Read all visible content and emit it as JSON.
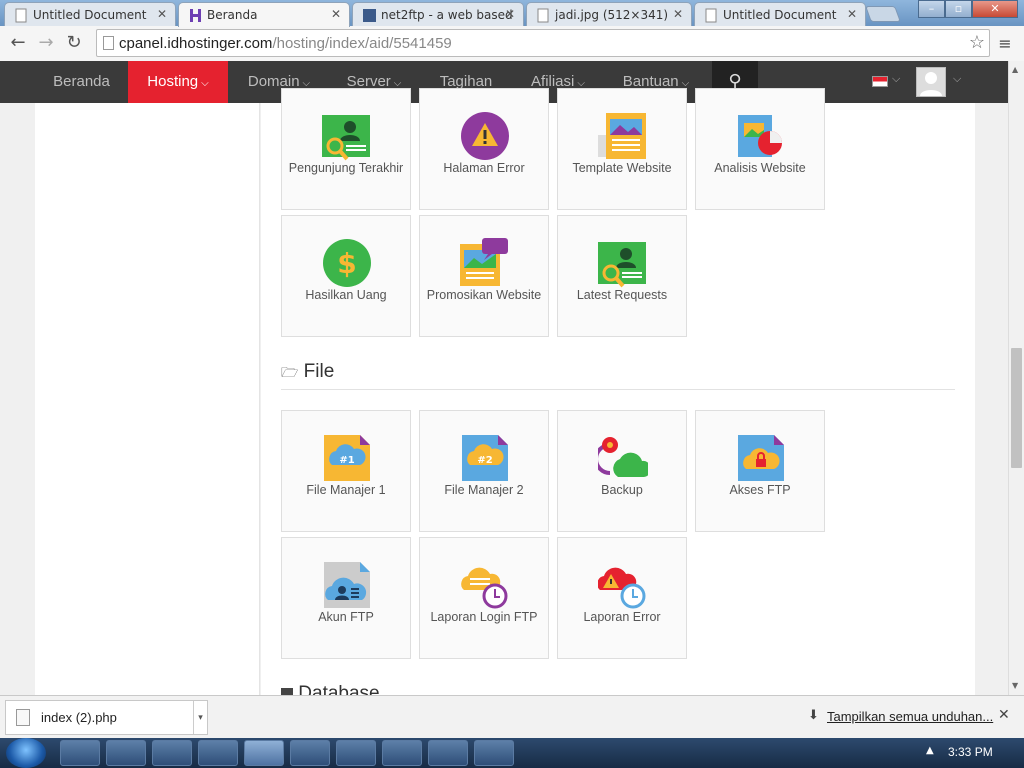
{
  "browser": {
    "tabs": [
      {
        "title": "Untitled Document",
        "active": false
      },
      {
        "title": "Beranda",
        "active": true
      },
      {
        "title": "net2ftp - a web based",
        "active": false
      },
      {
        "title": "jadi.jpg (512×341)",
        "active": false
      },
      {
        "title": "Untitled Document",
        "active": false
      }
    ],
    "url_host": "cpanel.idhostinger.com",
    "url_path": "/hosting/index/aid/5541459"
  },
  "site_nav": {
    "items": [
      {
        "label": "Beranda",
        "caret": false
      },
      {
        "label": "Hosting",
        "caret": true,
        "active": true
      },
      {
        "label": "Domain",
        "caret": true
      },
      {
        "label": "Server",
        "caret": true
      },
      {
        "label": "Tagihan",
        "caret": false
      },
      {
        "label": "Afiliasi",
        "caret": true
      },
      {
        "label": "Bantuan",
        "caret": true
      }
    ],
    "accent_color": "#e5222f"
  },
  "sections": {
    "top_tiles": [
      {
        "label": "Pengunjung Terakhir",
        "icon": "visitor-search-icon"
      },
      {
        "label": "Halaman Error",
        "icon": "warning-icon"
      },
      {
        "label": "Template Website",
        "icon": "template-icon"
      },
      {
        "label": "Analisis Website",
        "icon": "analytics-icon"
      },
      {
        "label": "Hasilkan Uang",
        "icon": "dollar-icon"
      },
      {
        "label": "Promosikan Website",
        "icon": "promote-icon"
      },
      {
        "label": "Latest Requests",
        "icon": "requests-icon"
      }
    ],
    "file_header": "File",
    "file_tiles": [
      {
        "label": "File Manajer 1",
        "badge": "#1",
        "icon": "file-manager-1-icon"
      },
      {
        "label": "File Manajer 2",
        "badge": "#2",
        "icon": "file-manager-2-icon"
      },
      {
        "label": "Backup",
        "icon": "backup-icon"
      },
      {
        "label": "Akses FTP",
        "icon": "ftp-access-icon"
      },
      {
        "label": "Akun FTP",
        "icon": "ftp-account-icon"
      },
      {
        "label": "Laporan Login FTP",
        "icon": "ftp-login-report-icon"
      },
      {
        "label": "Laporan Error",
        "icon": "error-report-icon"
      }
    ],
    "database_header": "Database"
  },
  "download_bar": {
    "file": "index (2).php",
    "show_all": "Tampilkan semua unduhan..."
  },
  "taskbar": {
    "time": "3:33 PM"
  }
}
